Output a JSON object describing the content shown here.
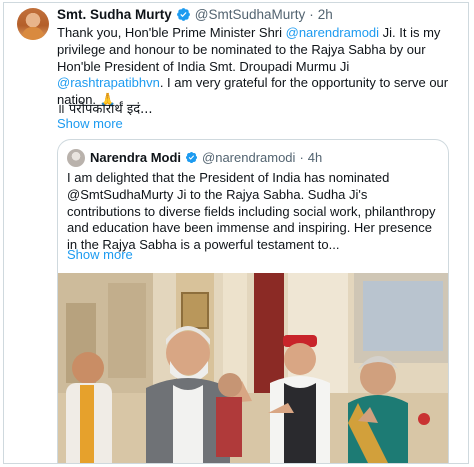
{
  "tweet": {
    "author_name": "Smt. Sudha Murty",
    "author_handle": "@SmtSudhaMurty",
    "separator": "·",
    "time": "2h",
    "text_parts": {
      "p1": "Thank you, Hon'ble Prime Minister Shri ",
      "m1": "@narendramodi",
      "p2": " Ji. It is my privilege and honour to be nominated to the Rajya Sabha by our Hon'ble President of India Smt. Droupadi Murmu Ji ",
      "m2": "@rashtrapatibhvn",
      "p3": ". I am very grateful for the opportunity to serve our nation. 🙏"
    },
    "hindi_line": "॥ परोपकारार्थं इदं...",
    "show_more": "Show more"
  },
  "quote": {
    "author_name": "Narendra Modi",
    "author_handle": "@narendramodi",
    "separator": "·",
    "time": "4h",
    "text": "I am delighted that the President of India has nominated @SmtSudhaMurty Ji to the Rajya Sabha. Sudha Ji's contributions to diverse fields including social work, philanthropy and education have been immense and inspiring. Her presence in the Rajya Sabha is a powerful testament to...",
    "show_more": "Show more"
  },
  "colors": {
    "link": "#1d9bf0",
    "verified": "#1d9bf0",
    "border": "#cfd9de",
    "muted": "#536471"
  },
  "icons": [
    "verified-badge-icon",
    "folded-hands-emoji"
  ]
}
